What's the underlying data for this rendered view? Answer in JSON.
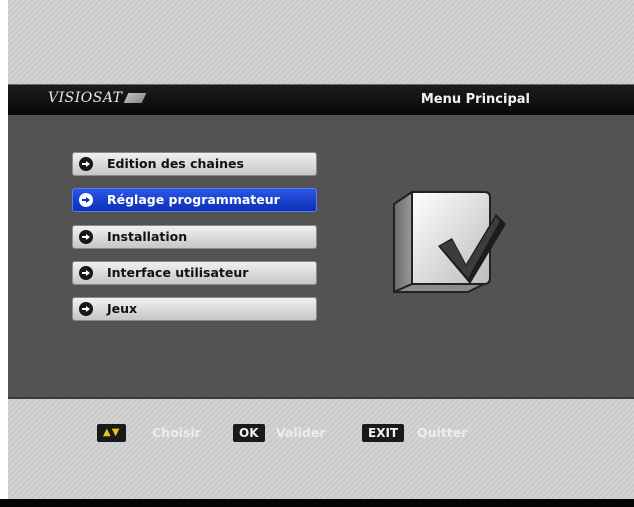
{
  "header": {
    "brand": "VISIOSAT",
    "title": "Menu Principal"
  },
  "menu": {
    "items": [
      {
        "label": "Edition des chaines",
        "selected": false
      },
      {
        "label": "Réglage programmateur",
        "selected": true
      },
      {
        "label": "Installation",
        "selected": false
      },
      {
        "label": "Interface utilisateur",
        "selected": false
      },
      {
        "label": "Jeux",
        "selected": false
      }
    ]
  },
  "icons": {
    "menu_bullet": "arrow-right-circle-icon",
    "illustration": "checkbox-check-icon"
  },
  "footer": {
    "nav_key": "▲▼",
    "nav_label": "Choisir",
    "ok_key": "OK",
    "ok_label": "Valider",
    "exit_key": "EXIT",
    "exit_label": "Quitter"
  },
  "colors": {
    "selected_item": "#1f46d8",
    "nav_arrows": "#e8c31a",
    "panel": "#535353",
    "header": "#111111"
  }
}
